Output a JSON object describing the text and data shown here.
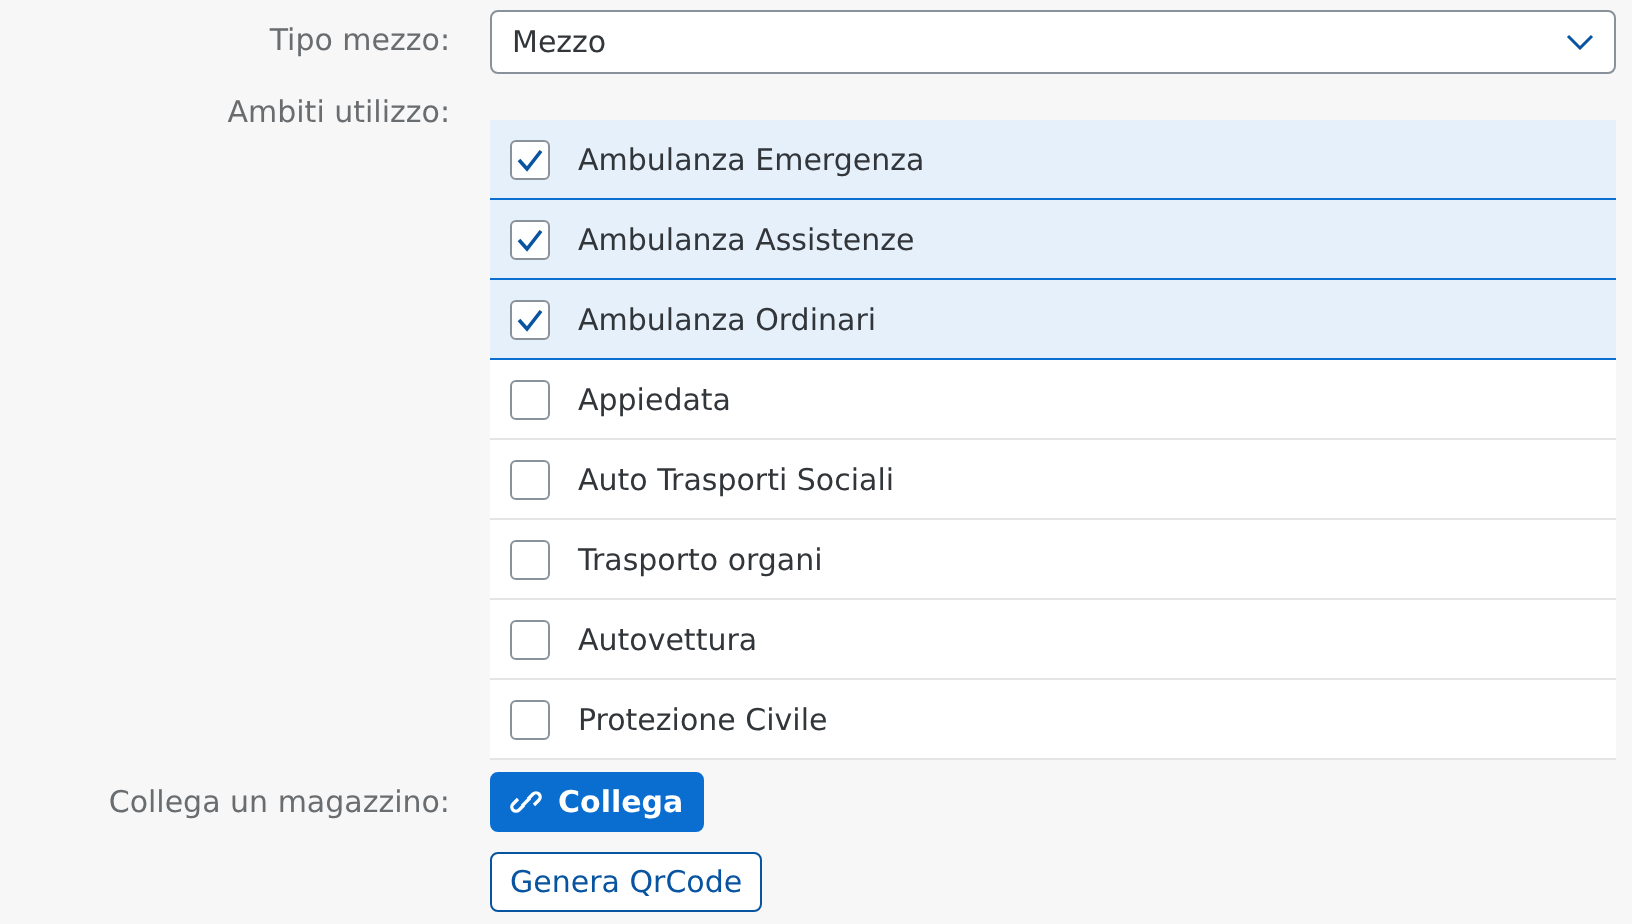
{
  "tipo_mezzo": {
    "label": "Tipo mezzo:",
    "value": "Mezzo"
  },
  "ambiti": {
    "label": "Ambiti utilizzo:",
    "items": [
      {
        "label": "Ambulanza Emergenza",
        "checked": true
      },
      {
        "label": "Ambulanza Assistenze",
        "checked": true
      },
      {
        "label": "Ambulanza Ordinari",
        "checked": true
      },
      {
        "label": "Appiedata",
        "checked": false
      },
      {
        "label": "Auto Trasporti Sociali",
        "checked": false
      },
      {
        "label": "Trasporto organi",
        "checked": false
      },
      {
        "label": "Autovettura",
        "checked": false
      },
      {
        "label": "Protezione Civile",
        "checked": false
      }
    ]
  },
  "magazzino": {
    "label": "Collega un magazzino:",
    "buttons": [
      {
        "label": "Collega",
        "kind": "emphasized"
      },
      {
        "label": "Genera QrCode",
        "kind": "ghost"
      }
    ]
  }
}
